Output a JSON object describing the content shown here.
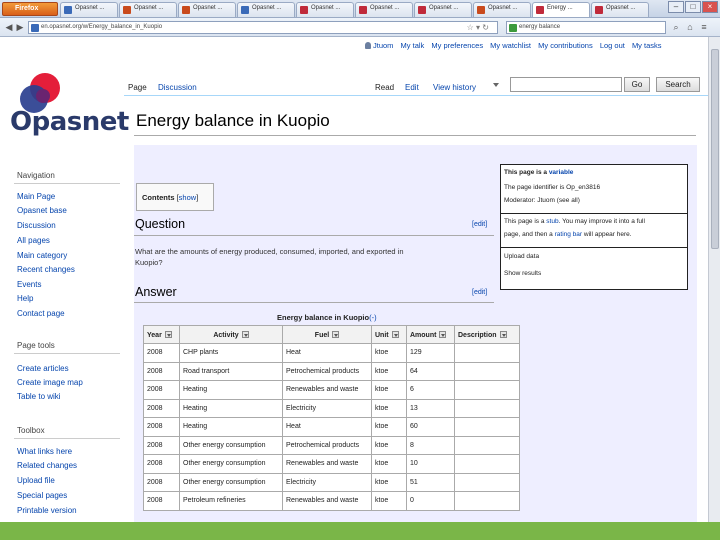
{
  "browser": {
    "menu_button": "Firefox",
    "tabs": [
      {
        "label": "Opasnet ...",
        "color": "#3a6ab8"
      },
      {
        "label": "Opasnet ...",
        "color": "#c94a1c"
      },
      {
        "label": "Opasnet ...",
        "color": "#c94a1c"
      },
      {
        "label": "Opasnet ...",
        "color": "#3a6ab8"
      },
      {
        "label": "Opasnet ...",
        "color": "#c02a3a"
      },
      {
        "label": "Opasnet ...",
        "color": "#c02a3a"
      },
      {
        "label": "Opasnet ...",
        "color": "#c02a3a"
      },
      {
        "label": "Opasnet ...",
        "color": "#c94a1c"
      },
      {
        "label": "Energy ...",
        "color": "#c02a3a"
      },
      {
        "label": "Opasnet ...",
        "color": "#c02a3a"
      }
    ],
    "url": "en.opasnet.org/w/Energy_balance_in_Kuopio",
    "search_text": "energy balance"
  },
  "personal": {
    "user": "Jtuom",
    "links": [
      "My talk",
      "My preferences",
      "My watchlist",
      "My contributions",
      "Log out",
      "My tasks"
    ]
  },
  "logo": {
    "text": "Opasnet"
  },
  "page_tabs": {
    "left": [
      "Page",
      "Discussion"
    ],
    "right": [
      "Read",
      "Edit",
      "View history"
    ]
  },
  "search": {
    "go": "Go",
    "search": "Search"
  },
  "title": "Energy balance in Kuopio",
  "sidebar": {
    "navigation_heading": "Navigation",
    "navigation": [
      "Main Page",
      "Opasnet base",
      "Discussion",
      "All pages",
      "Main category",
      "Recent changes",
      "Events",
      "Help",
      "Contact page"
    ],
    "pagetools_heading": "Page tools",
    "pagetools": [
      "Create articles",
      "Create image map",
      "Table to wiki"
    ],
    "toolbox_heading": "Toolbox",
    "toolbox": [
      "What links here",
      "Related changes",
      "Upload file",
      "Special pages",
      "Printable version"
    ]
  },
  "infobox": {
    "variable_prefix": "This page is a",
    "variable_link": "variable",
    "moderator_line1": "The page identifier is Op_en3816",
    "moderator_line2": "Moderator: Jtuom (see all)",
    "stub_line1_pre": "This page is a",
    "stub_line1_link": "stub",
    "stub_line1_post": ". You may improve it into a full",
    "stub_line2_pre": "page, and then a",
    "stub_line2_link": "rating bar",
    "stub_line2_post": "will appear here.",
    "upload_data": "Upload data",
    "show_results": "Show results"
  },
  "toc": {
    "label": "Contents",
    "toggle": "show"
  },
  "sections": [
    {
      "heading": "Question",
      "edit": "[edit]",
      "text_line1": "What are the amounts of energy produced, consumed, imported, and exported in",
      "text_line2": "Kuopio?"
    },
    {
      "heading": "Answer",
      "edit": "[edit]"
    }
  ],
  "table": {
    "caption": "Energy balance in Kuopio",
    "caption_link": "(-)",
    "columns": [
      "Year",
      "Activity",
      "Fuel",
      "Unit",
      "Amount",
      "Description"
    ],
    "rows": [
      [
        "2008",
        "CHP plants",
        "Heat",
        "ktoe",
        "129",
        ""
      ],
      [
        "2008",
        "Road transport",
        "Petrochemical products",
        "ktoe",
        "64",
        ""
      ],
      [
        "2008",
        "Heating",
        "Renewables and waste",
        "ktoe",
        "6",
        ""
      ],
      [
        "2008",
        "Heating",
        "Electricity",
        "ktoe",
        "13",
        ""
      ],
      [
        "2008",
        "Heating",
        "Heat",
        "ktoe",
        "60",
        ""
      ],
      [
        "2008",
        "Other energy consumption",
        "Petrochemical products",
        "ktoe",
        "8",
        ""
      ],
      [
        "2008",
        "Other energy consumption",
        "Renewables and waste",
        "ktoe",
        "10",
        ""
      ],
      [
        "2008",
        "Other energy consumption",
        "Electricity",
        "ktoe",
        "51",
        ""
      ],
      [
        "2008",
        "Petroleum refineries",
        "Renewables and waste",
        "ktoe",
        "0",
        ""
      ]
    ]
  }
}
